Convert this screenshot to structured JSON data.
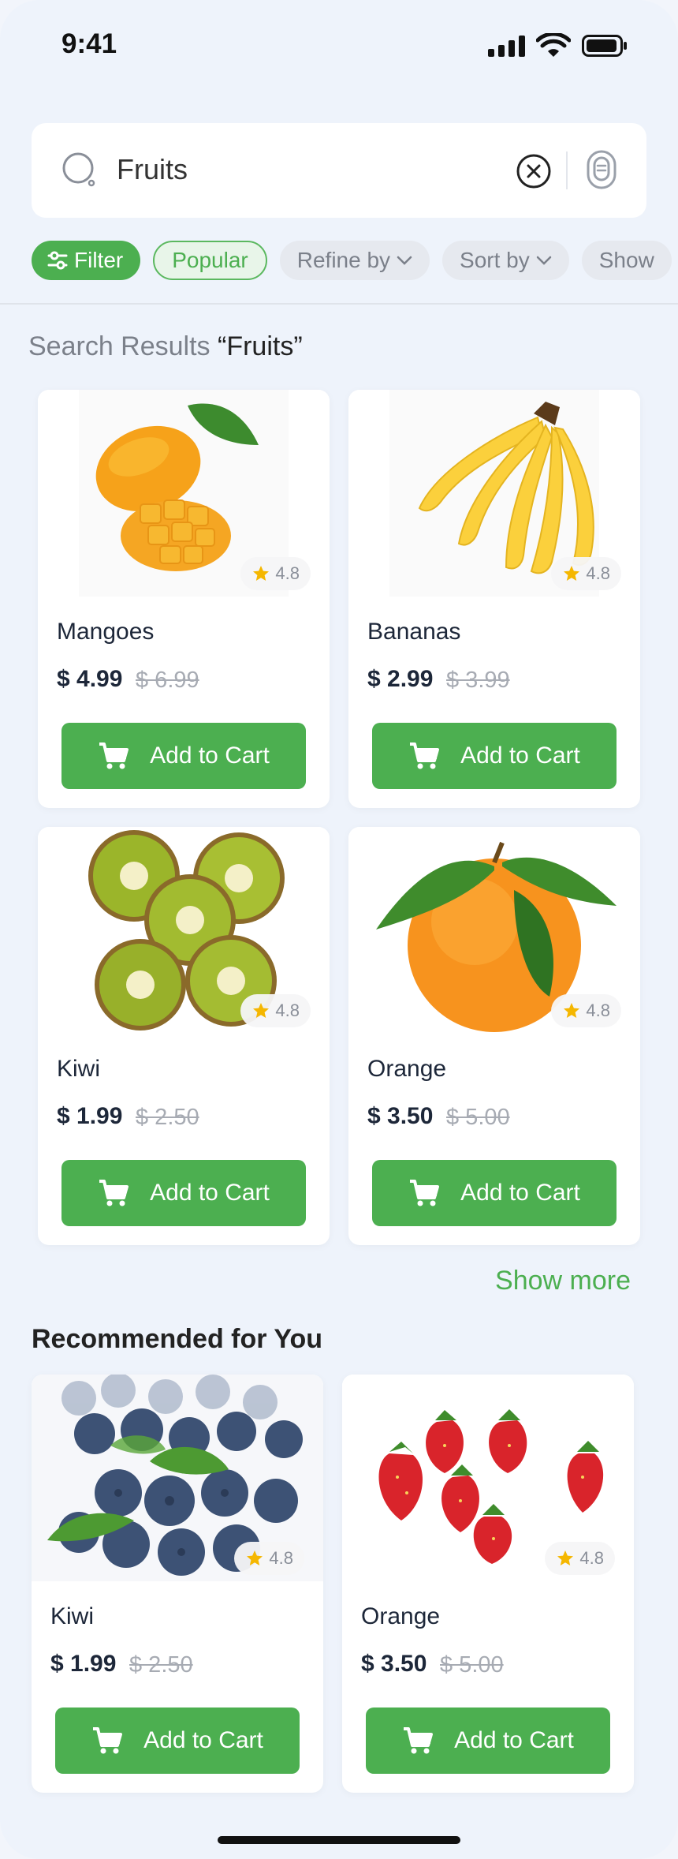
{
  "status_bar": {
    "time": "9:41"
  },
  "search": {
    "query": "Fruits"
  },
  "chips": {
    "filter": "Filter",
    "popular": "Popular",
    "refine": "Refine by",
    "sort": "Sort by",
    "show": "Show"
  },
  "results": {
    "label": "Search Results ",
    "query": "“Fruits”",
    "products": [
      {
        "name": "Mangoes",
        "price": "$ 4.99",
        "old_price": "$ 6.99",
        "rating": "4.8",
        "cta": "Add to Cart",
        "image": "mango"
      },
      {
        "name": "Bananas",
        "price": "$ 2.99",
        "old_price": "$ 3.99",
        "rating": "4.8",
        "cta": "Add to Cart",
        "image": "banana"
      },
      {
        "name": "Kiwi",
        "price": "$ 1.99",
        "old_price": "$ 2.50",
        "rating": "4.8",
        "cta": "Add to Cart",
        "image": "kiwi"
      },
      {
        "name": "Orange",
        "price": "$ 3.50",
        "old_price": "$ 5.00",
        "rating": "4.8",
        "cta": "Add to Cart",
        "image": "orange"
      }
    ],
    "show_more": "Show more"
  },
  "recommended": {
    "title": "Recommended for You",
    "products": [
      {
        "name": "Kiwi",
        "price": "$ 1.99",
        "old_price": "$ 2.50",
        "rating": "4.8",
        "cta": "Add to Cart",
        "image": "blueberries"
      },
      {
        "name": "Orange",
        "price": "$ 3.50",
        "old_price": "$ 5.00",
        "rating": "4.8",
        "cta": "Add to Cart",
        "image": "strawberries"
      }
    ]
  },
  "colors": {
    "accent": "#4caf50",
    "background": "#eef3fb",
    "star": "#f5b700"
  }
}
